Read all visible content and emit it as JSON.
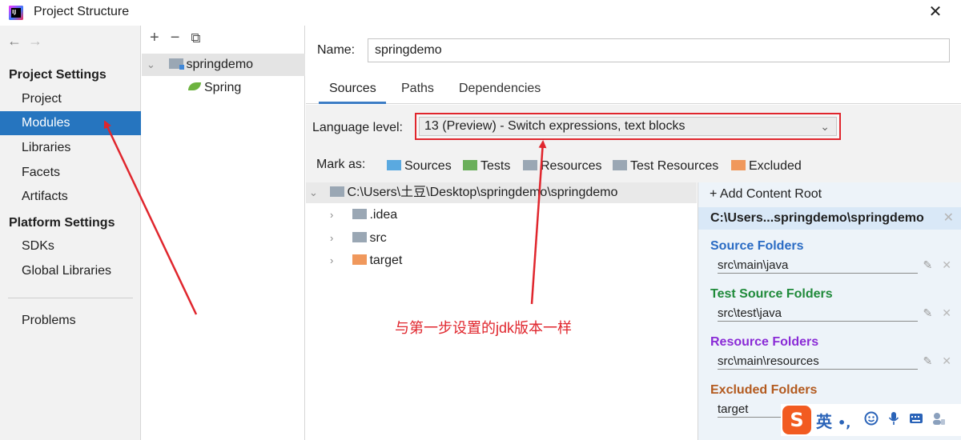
{
  "window": {
    "title": "Project Structure",
    "close_label": "✕"
  },
  "nav": {
    "back": "←",
    "forward": "→",
    "project_settings_heading": "Project Settings",
    "project_settings_items": [
      "Project",
      "Modules",
      "Libraries",
      "Facets",
      "Artifacts"
    ],
    "platform_settings_heading": "Platform Settings",
    "platform_settings_items": [
      "SDKs",
      "Global Libraries"
    ],
    "problems": "Problems",
    "selected": "Modules"
  },
  "modules": {
    "toolbar": {
      "add": "+",
      "remove": "−",
      "copy": "⧉"
    },
    "tree": [
      {
        "label": "springdemo",
        "expanded": true,
        "selected": true
      },
      {
        "label": "Spring"
      }
    ]
  },
  "module": {
    "name_label": "Name:",
    "name_value": "springdemo",
    "tabs": [
      "Sources",
      "Paths",
      "Dependencies"
    ],
    "active_tab": "Sources",
    "language_level_label": "Language level:",
    "language_level_value": "13 (Preview) - Switch expressions, text blocks",
    "mark_as_label": "Mark as:",
    "mark_as": [
      {
        "label": "Sources",
        "color": "#5aa9e0"
      },
      {
        "label": "Tests",
        "color": "#6aaf5a"
      },
      {
        "label": "Resources",
        "color": "#9aa7b4"
      },
      {
        "label": "Test Resources",
        "color": "#9aa7b4"
      },
      {
        "label": "Excluded",
        "color": "#f0985c"
      }
    ]
  },
  "content_tree": {
    "root": "C:\\Users\\土豆\\Desktop\\springdemo\\springdemo",
    "children": [
      {
        "label": ".idea",
        "color": "#9aa7b4"
      },
      {
        "label": "src",
        "color": "#9aa7b4"
      },
      {
        "label": "target",
        "color": "#f0985c"
      }
    ]
  },
  "content_root_panel": {
    "add_label": "Add Content Root",
    "root_label": "C:\\Users...springdemo\\springdemo",
    "sections": [
      {
        "title": "Source Folders",
        "path": "src\\main\\java",
        "color": "#2a6bc4"
      },
      {
        "title": "Test Source Folders",
        "path": "src\\test\\java",
        "color": "#1f8a3a"
      },
      {
        "title": "Resource Folders",
        "path": "src\\main\\resources",
        "color": "#8a2bd6"
      },
      {
        "title": "Excluded Folders",
        "path": "target",
        "color": "#b35a1f"
      }
    ]
  },
  "ime": {
    "logo": "S",
    "mode": "英",
    "punct": "•,"
  },
  "annotation": {
    "text": "与第一步设置的jdk版本一样",
    "color": "#e0262d"
  }
}
